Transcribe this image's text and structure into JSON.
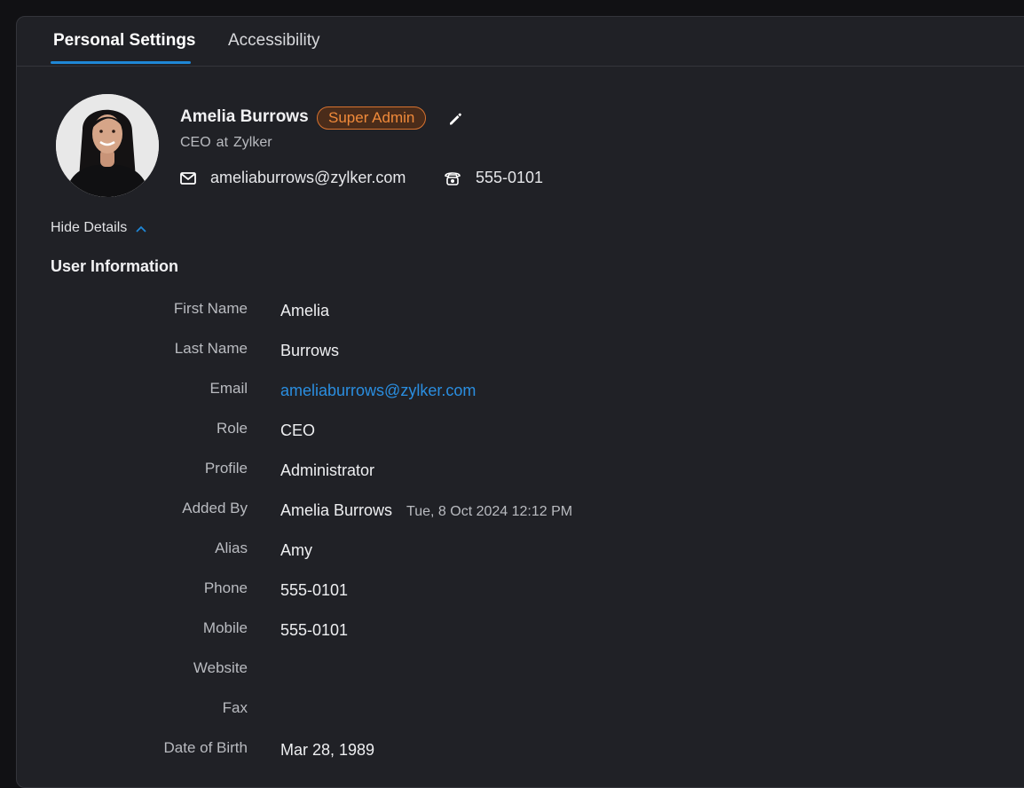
{
  "tabs": [
    {
      "label": "Personal Settings",
      "active": true
    },
    {
      "label": "Accessibility",
      "active": false
    }
  ],
  "profile": {
    "name": "Amelia Burrows",
    "badge": "Super Admin",
    "role": "CEO",
    "at": "at",
    "company": "Zylker",
    "email": "ameliaburrows@zylker.com",
    "phone": "555-0101"
  },
  "hide_details_label": "Hide Details",
  "user_information": {
    "title": "User Information",
    "rows": [
      {
        "label": "First Name",
        "value": "Amelia"
      },
      {
        "label": "Last Name",
        "value": "Burrows"
      },
      {
        "label": "Email",
        "value": "ameliaburrows@zylker.com"
      },
      {
        "label": "Role",
        "value": "CEO"
      },
      {
        "label": "Profile",
        "value": "Administrator"
      },
      {
        "label": "Added By",
        "value": "Amelia Burrows",
        "timestamp": "Tue, 8 Oct 2024 12:12 PM"
      },
      {
        "label": "Alias",
        "value": "Amy"
      },
      {
        "label": "Phone",
        "value": "555-0101"
      },
      {
        "label": "Mobile",
        "value": "555-0101"
      },
      {
        "label": "Website",
        "value": ""
      },
      {
        "label": "Fax",
        "value": ""
      },
      {
        "label": "Date of Birth",
        "value": "Mar 28, 1989"
      }
    ]
  },
  "colors": {
    "accent": "#1f87d6",
    "badge_border": "#d9732f",
    "badge_text": "#f08a3a",
    "link": "#2a8ee0"
  },
  "icons": {
    "edit": "pencil-icon",
    "email": "mail-icon",
    "phone": "telephone-icon",
    "collapse": "chevron-up-icon"
  }
}
